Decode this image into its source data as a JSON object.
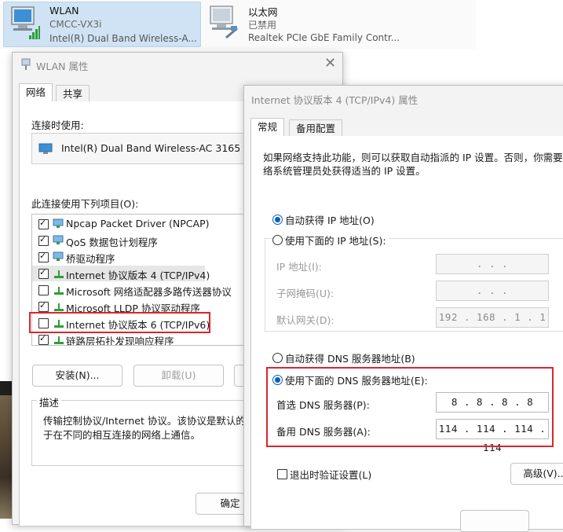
{
  "adapters": [
    {
      "name": "WLAN",
      "status": "CMCC-VX3i",
      "device": "Intel(R) Dual Band Wireless-A..."
    },
    {
      "name": "以太网",
      "status": "已禁用",
      "device": "Realtek PCIe GbE Family Contr..."
    }
  ],
  "wlan_dialog": {
    "title": "WLAN 属性",
    "tabs": [
      "网络",
      "共享"
    ],
    "connect_using_label": "连接时使用:",
    "adapter_name": "Intel(R) Dual Band Wireless-AC 3165",
    "items_label": "此连接使用下列项目(O):",
    "items": [
      {
        "label": "Npcap Packet Driver (NPCAP)",
        "checked": true
      },
      {
        "label": "QoS 数据包计划程序",
        "checked": true
      },
      {
        "label": "桥驱动程序",
        "checked": true
      },
      {
        "label": "Internet 协议版本 4 (TCP/IPv4)",
        "checked": true
      },
      {
        "label": "Microsoft 网络适配器多路传送器协议",
        "checked": false
      },
      {
        "label": "Microsoft LLDP 协议驱动程序",
        "checked": true
      },
      {
        "label": "Internet 协议版本 6 (TCP/IPv6)",
        "checked": false
      },
      {
        "label": "链路层拓扑发现响应程序",
        "checked": true
      }
    ],
    "install_button": "安装(N)...",
    "uninstall_button": "卸载(U)",
    "description_label": "描述",
    "description_line1": "传输控制协议/Internet 协议。该协议是默认的广",
    "description_line2": "于在不同的相互连接的网络上通信。",
    "ok_button": "确定"
  },
  "ipv4_dialog": {
    "title": "Internet 协议版本 4 (TCP/IPv4) 属性",
    "tabs": [
      "常规",
      "备用配置"
    ],
    "intro_line1": "如果网络支持此功能，则可以获取自动指派的 IP 设置。否则，你需要从",
    "intro_line2": "络系统管理员处获得适当的 IP 设置。",
    "auto_ip_label": "自动获得 IP 地址(O)",
    "manual_ip_label": "使用下面的 IP 地址(S):",
    "ip_address_label": "IP 地址(I):",
    "subnet_mask_label": "子网掩码(U):",
    "gateway_label": "默认网关(D):",
    "ip_address_value": ".       .       .",
    "subnet_mask_value": ".       .       .",
    "gateway_value": "192 . 168 .  1  .  1",
    "auto_dns_label": "自动获得 DNS 服务器地址(B)",
    "manual_dns_label": "使用下面的 DNS 服务器地址(E):",
    "preferred_dns_label": "首选 DNS 服务器(P):",
    "alternate_dns_label": "备用 DNS 服务器(A):",
    "preferred_dns_value": "8  .  8  .  8  .  8",
    "alternate_dns_value": "114 . 114 . 114 . 114",
    "validate_label": "退出时验证设置(L)",
    "advanced_button": "高级(V)..."
  },
  "colors": {
    "highlight_box": "#d9262f",
    "radio_accent": "#0a5fc2",
    "selected_adapter": "#cfe3f4"
  }
}
